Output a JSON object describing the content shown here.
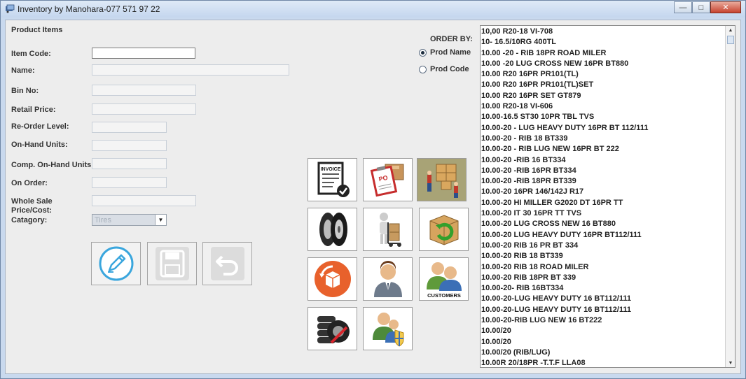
{
  "window": {
    "title": "Inventory by Manohara-077 571 97 22",
    "controls": {
      "minimize": "—",
      "maximize": "□",
      "close": "✕"
    }
  },
  "form": {
    "section_title": "Product Items",
    "fields": [
      {
        "label": "Item Code:",
        "value": ""
      },
      {
        "label": "Name:",
        "value": ""
      },
      {
        "label": "Bin No:",
        "value": ""
      },
      {
        "label": "Retail Price:",
        "value": ""
      },
      {
        "label": "Re-Order Level:",
        "value": ""
      },
      {
        "label": "On-Hand Units:",
        "value": ""
      },
      {
        "label": "Comp. On-Hand Units:",
        "value": ""
      },
      {
        "label": "On Order:",
        "value": ""
      },
      {
        "label": "Whole Sale Price/Cost:",
        "value": ""
      }
    ],
    "category": {
      "label": "Catagory:",
      "value": "Tires"
    }
  },
  "actions": {
    "edit": "edit-pencil-icon",
    "save": "save-disk-icon",
    "undo": "undo-icon"
  },
  "order_by": {
    "label": "ORDER BY:",
    "options": [
      {
        "label": "Prod Name",
        "selected": true
      },
      {
        "label": "Prod Code",
        "selected": false
      }
    ]
  },
  "tiles": [
    {
      "name": "invoice-tile",
      "icon": "invoice-icon",
      "text": "INVOICE"
    },
    {
      "name": "purchase-order-tile",
      "icon": "purchase-order-icon",
      "text": "PO"
    },
    {
      "name": "stock-receiving-tile",
      "icon": "workers-boxes-icon",
      "text": ""
    },
    {
      "name": "tires-tile",
      "icon": "tires-icon",
      "text": ""
    },
    {
      "name": "delivery-tile",
      "icon": "hand-truck-icon",
      "text": ""
    },
    {
      "name": "stock-return-tile",
      "icon": "box-return-icon",
      "text": ""
    },
    {
      "name": "returns-tile",
      "icon": "return-box-icon",
      "text": ""
    },
    {
      "name": "user-tile",
      "icon": "user-icon",
      "text": ""
    },
    {
      "name": "customers-tile",
      "icon": "customers-icon",
      "text": "CUSTOMERS"
    },
    {
      "name": "tire-stock-tile",
      "icon": "tire-stack-icon",
      "text": ""
    },
    {
      "name": "user-security-tile",
      "icon": "users-security-icon",
      "text": ""
    }
  ],
  "products": [
    "10,00 R20-18 VI-708",
    "10- 16.5/10RG 400TL",
    "10.00 -20 - RIB 18PR ROAD MILER",
    "10.00 -20 LUG CROSS NEW 16PR BT880",
    "10.00 R20 16PR PR101(TL)",
    "10.00 R20 16PR PR101(TL)SET",
    "10.00 R20 16PR SET GT879",
    "10.00 R20-18 VI-606",
    "10.00-16.5 ST30 10PR TBL TVS",
    "10.00-20 - LUG HEAVY DUTY 16PR BT 112/111",
    "10.00-20 - RIB 18 BT339",
    "10.00-20 - RIB LUG NEW 16PR BT 222",
    "10.00-20 -RIB 16 BT334",
    "10.00-20 -RIB 16PR BT334",
    "10.00-20 -RIB 18PR BT339",
    "10.00-20 16PR 146/142J R17",
    "10.00-20 HI MILLER G2020 DT 16PR TT",
    "10.00-20 IT 30 16PR TT TVS",
    "10.00-20 LUG CROSS NEW 16 BT880",
    "10.00-20 LUG HEAVY DUTY 16PR BT112/111",
    "10.00-20 RIB 16 PR BT 334",
    "10.00-20 RIB 18 BT339",
    "10.00-20 RIB 18 ROAD MILER",
    "10.00-20 RIB 18PR BT 339",
    "10.00-20- RIB 16BT334",
    "10.00-20-LUG HEAVY DUTY 16 BT112/111",
    "10.00-20-LUG HEAVY DUTY 16 BT112/111",
    "10.00-20-RIB LUG NEW 16 BT222",
    "10.00/20",
    "10.00/20",
    "10.00/20 (RIB/LUG)",
    "10.00R 20/18PR -T.T.F LLA08"
  ]
}
